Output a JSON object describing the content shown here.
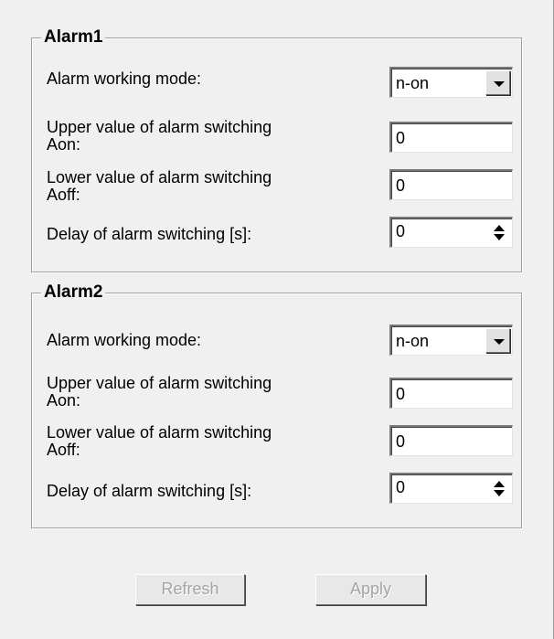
{
  "alarms": [
    {
      "title": "Alarm1",
      "mode_label": "Alarm working mode:",
      "mode_value": "n-on",
      "upper_label_line1": "Upper value of alarm switching",
      "upper_label_line2": "Aon:",
      "upper_value": "0",
      "lower_label_line1": "Lower value of alarm switching",
      "lower_label_line2": "Aoff:",
      "lower_value": "0",
      "delay_label": "Delay of alarm switching [s]:",
      "delay_value": "0"
    },
    {
      "title": "Alarm2",
      "mode_label": "Alarm working mode:",
      "mode_value": "n-on",
      "upper_label_line1": "Upper value of alarm switching",
      "upper_label_line2": "Aon:",
      "upper_value": "0",
      "lower_label_line1": "Lower value of alarm switching",
      "lower_label_line2": "Aoff:",
      "lower_value": "0",
      "delay_label": "Delay of alarm switching [s]:",
      "delay_value": "0"
    }
  ],
  "buttons": {
    "refresh_label": "Refresh",
    "apply_label": "Apply",
    "refresh_enabled": false,
    "apply_enabled": false
  },
  "icons": {
    "dropdown": "chevron-down-icon",
    "spinner": "spinner-arrows-icon"
  }
}
